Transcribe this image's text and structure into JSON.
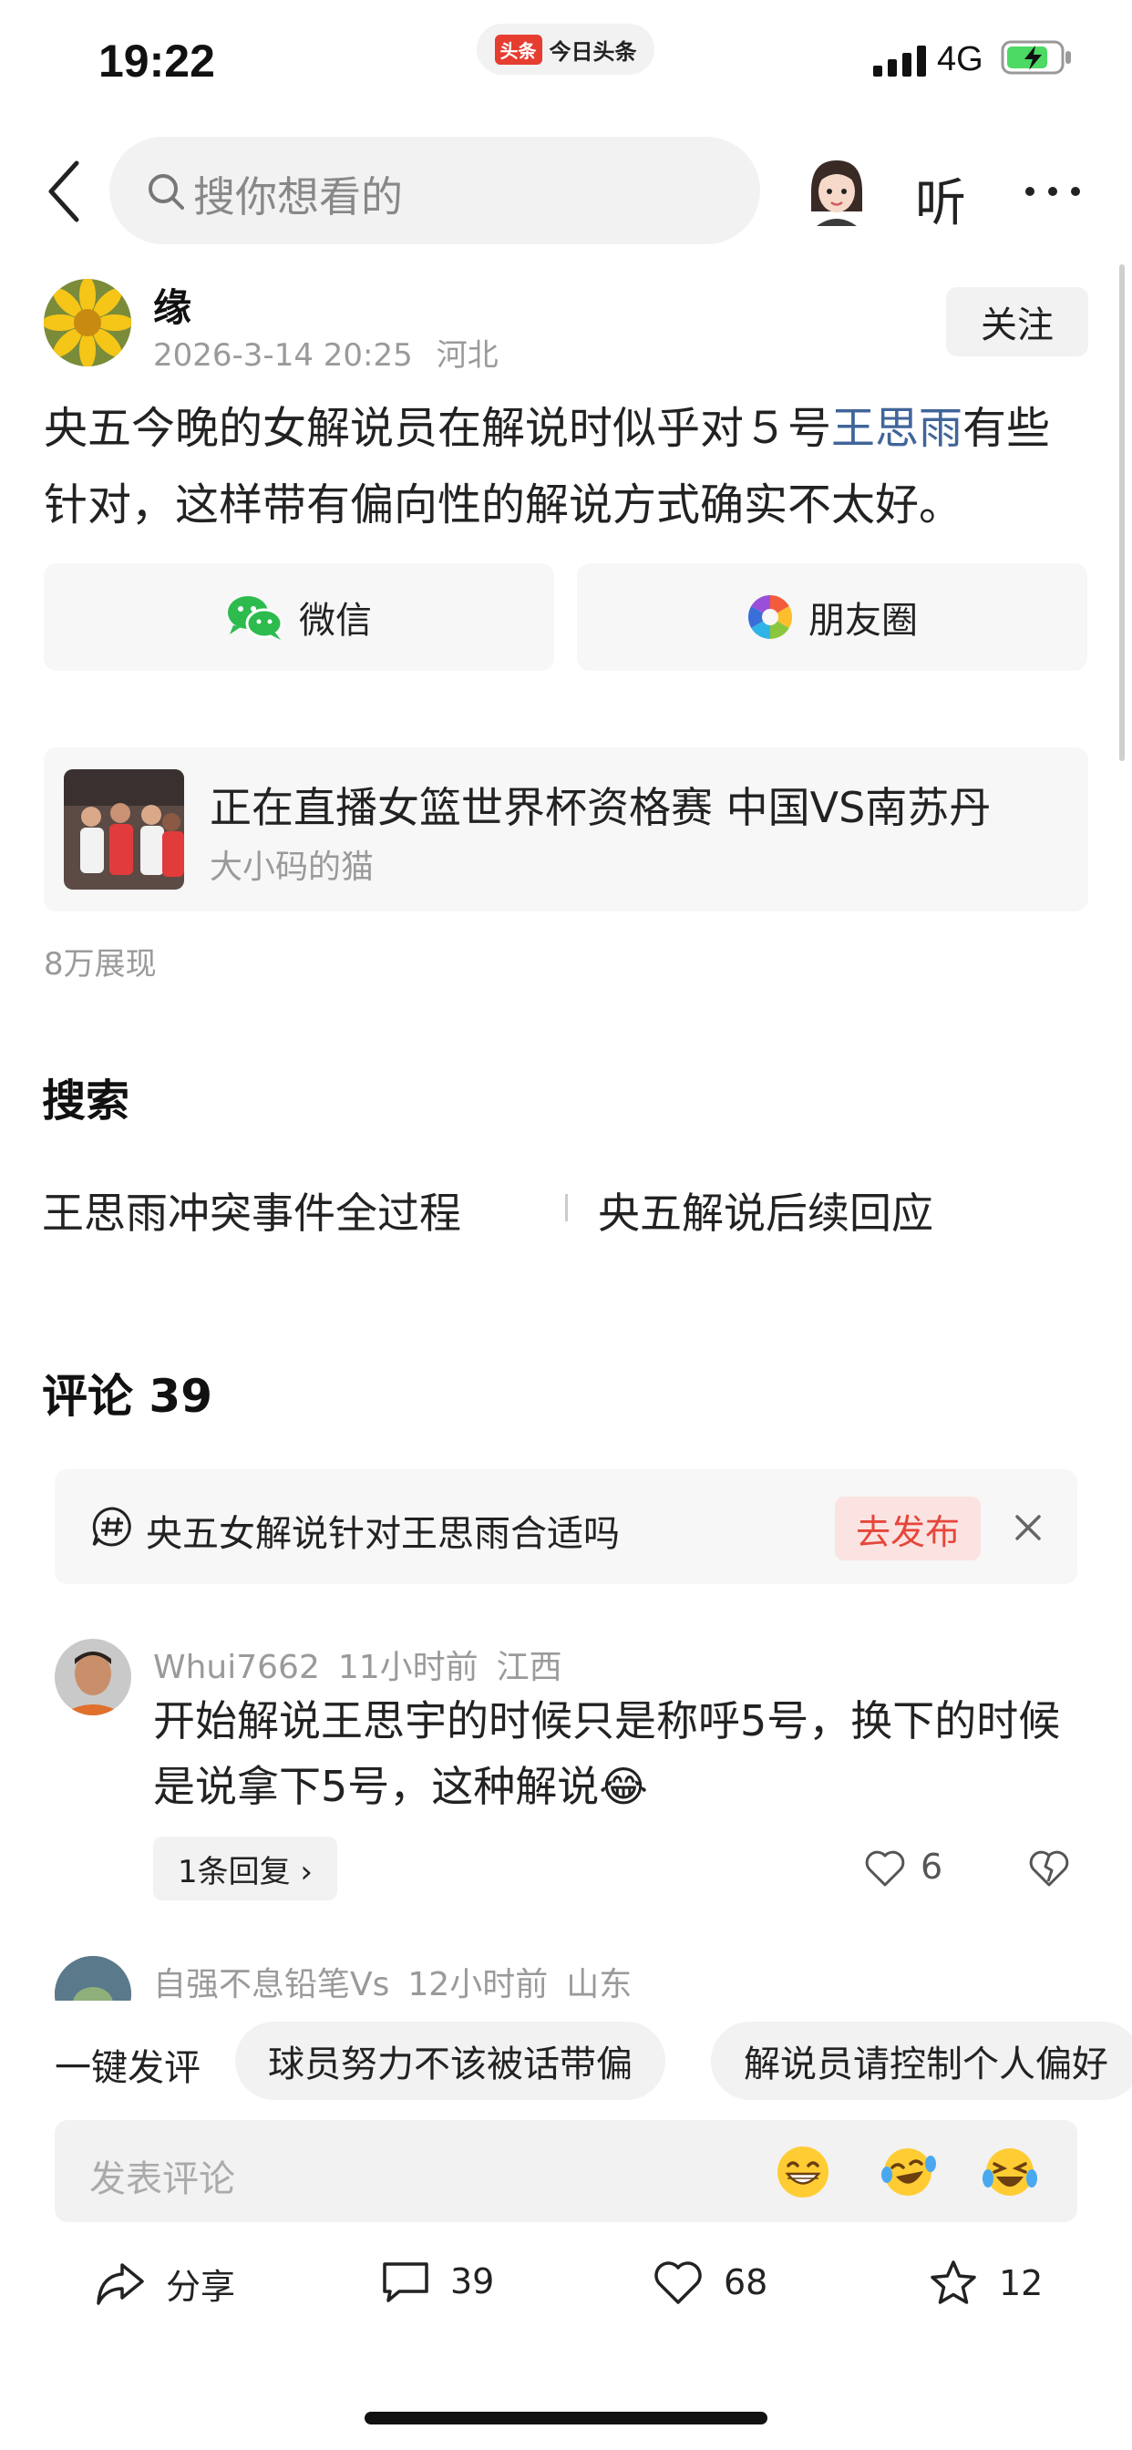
{
  "status_bar": {
    "time": "19:22",
    "app_badge": "头条",
    "app_name": "今日头条",
    "network": "4G"
  },
  "nav": {
    "search_placeholder": "搜你想看的",
    "listen_label": "听"
  },
  "post": {
    "author": "缘",
    "date": "2026-3-14 20:25",
    "location": "河北",
    "follow_label": "关注",
    "text_before": "央五今晚的女解说员在解说时似乎对５号",
    "text_highlight": "王思雨",
    "text_after": "有些针对，这样带有偏向性的解说方式确实不太好。",
    "share_wechat": "微信",
    "share_moments": "朋友圈"
  },
  "live_card": {
    "title": "正在直播女篮世界杯资格赛 中国VS南苏丹",
    "subtitle": "大小码的猫"
  },
  "views": "8万展现",
  "search_section": {
    "heading": "搜索",
    "suggestions": [
      "王思雨冲突事件全过程",
      "央五解说后续回应"
    ]
  },
  "comments": {
    "heading": "评论 39",
    "topic": {
      "text": "央五女解说针对王思雨合适吗",
      "button": "去发布"
    },
    "items": [
      {
        "user": "Whui7662",
        "time": "11小时前",
        "location": "江西",
        "text": "开始解说王思宇的时候只是称呼5号，换下的时候是说拿下5号，这种解说😂",
        "replies": "1条回复 ›",
        "likes": "6"
      },
      {
        "user": "自强不息铅笔Vs",
        "time": "12小时前",
        "location": "山东"
      }
    ]
  },
  "bottom": {
    "quick_label": "一键发评",
    "chips": [
      "球员努力不该被话带偏",
      "解说员请控制个人偏好"
    ],
    "input_placeholder": "发表评论",
    "emojis": [
      "😁",
      "😂",
      "🤣"
    ],
    "actions": {
      "share": "分享",
      "comments": "39",
      "likes": "68",
      "favorites": "12"
    }
  }
}
